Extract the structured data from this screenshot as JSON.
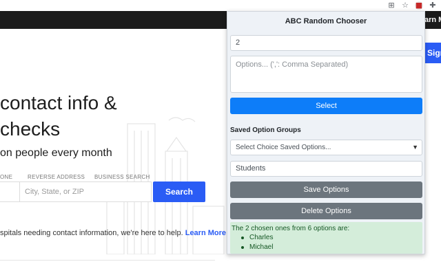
{
  "browser": {
    "extension_icons": [
      "translate-icon",
      "star-icon",
      "extension-icon",
      "puzzle-icon"
    ],
    "translate_glyph": "⊞",
    "star_glyph": "☆",
    "extension_glyph": "■",
    "puzzle_glyph": "✚"
  },
  "website": {
    "nav_right_label": "arn M",
    "sign_button": "Sign",
    "hero_line1": "contact info &",
    "hero_line2": "checks",
    "hero_sub": "on people every month",
    "search_labels": [
      "ONE",
      "REVERSE ADDRESS",
      "BUSINESS SEARCH"
    ],
    "search_placeholder": "City, State, or ZIP",
    "search_button": "Search",
    "hospitals_text": "spitals needing contact information, we're here to help.",
    "learn_more": "Learn More"
  },
  "popup": {
    "title": "ABC Random Chooser",
    "count_value": "2",
    "options_placeholder": "Options... (',': Comma Separated)",
    "select_button": "Select",
    "saved_groups_heading": "Saved Option Groups",
    "saved_select_value": "Select Choice Saved Options...",
    "group_name_value": "Students",
    "save_button": "Save Options",
    "delete_button": "Delete Options",
    "result_text": "The 2 chosen ones from 6 options are:",
    "chosen": [
      "Charles",
      "Michael"
    ]
  },
  "colors": {
    "primary": "#0d7df9",
    "secondary": "#6c757d",
    "success_bg": "#d4edda",
    "success_text": "#155724",
    "site_blue": "#2a5cf5",
    "site_nav": "#1b1b1b"
  }
}
